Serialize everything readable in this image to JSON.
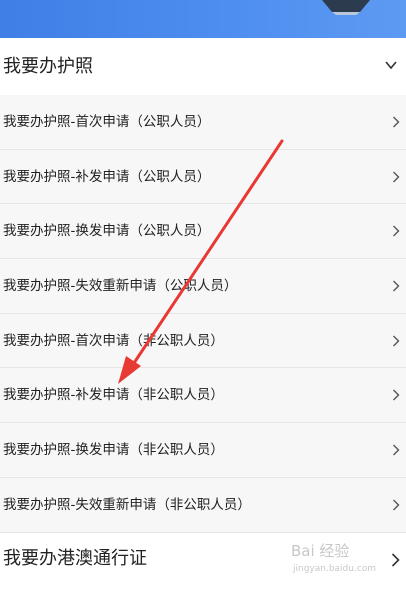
{
  "header": {
    "title": "我要办护照",
    "expand_icon": "chevron-down-icon"
  },
  "passport_items": [
    {
      "label": "我要办护照-首次申请（公职人员）"
    },
    {
      "label": "我要办护照-补发申请（公职人员）"
    },
    {
      "label": "我要办护照-换发申请（公职人员）"
    },
    {
      "label": "我要办护照-失效重新申请（公职人员）"
    },
    {
      "label": "我要办护照-首次申请（非公职人员）"
    },
    {
      "label": "我要办护照-补发申请（非公职人员）"
    },
    {
      "label": "我要办护照-换发申请（非公职人员）"
    },
    {
      "label": "我要办护照-失效重新申请（非公职人员）"
    }
  ],
  "footer": {
    "title": "我要办港澳通行证",
    "icon": "chevron-right-icon"
  },
  "watermark": {
    "text": "Bai 经验",
    "sub": "jingyan.baidu.com"
  },
  "colors": {
    "banner": "#4f8ff0",
    "annotation_arrow": "#e83a35",
    "row_background": "#f7f7f7"
  }
}
